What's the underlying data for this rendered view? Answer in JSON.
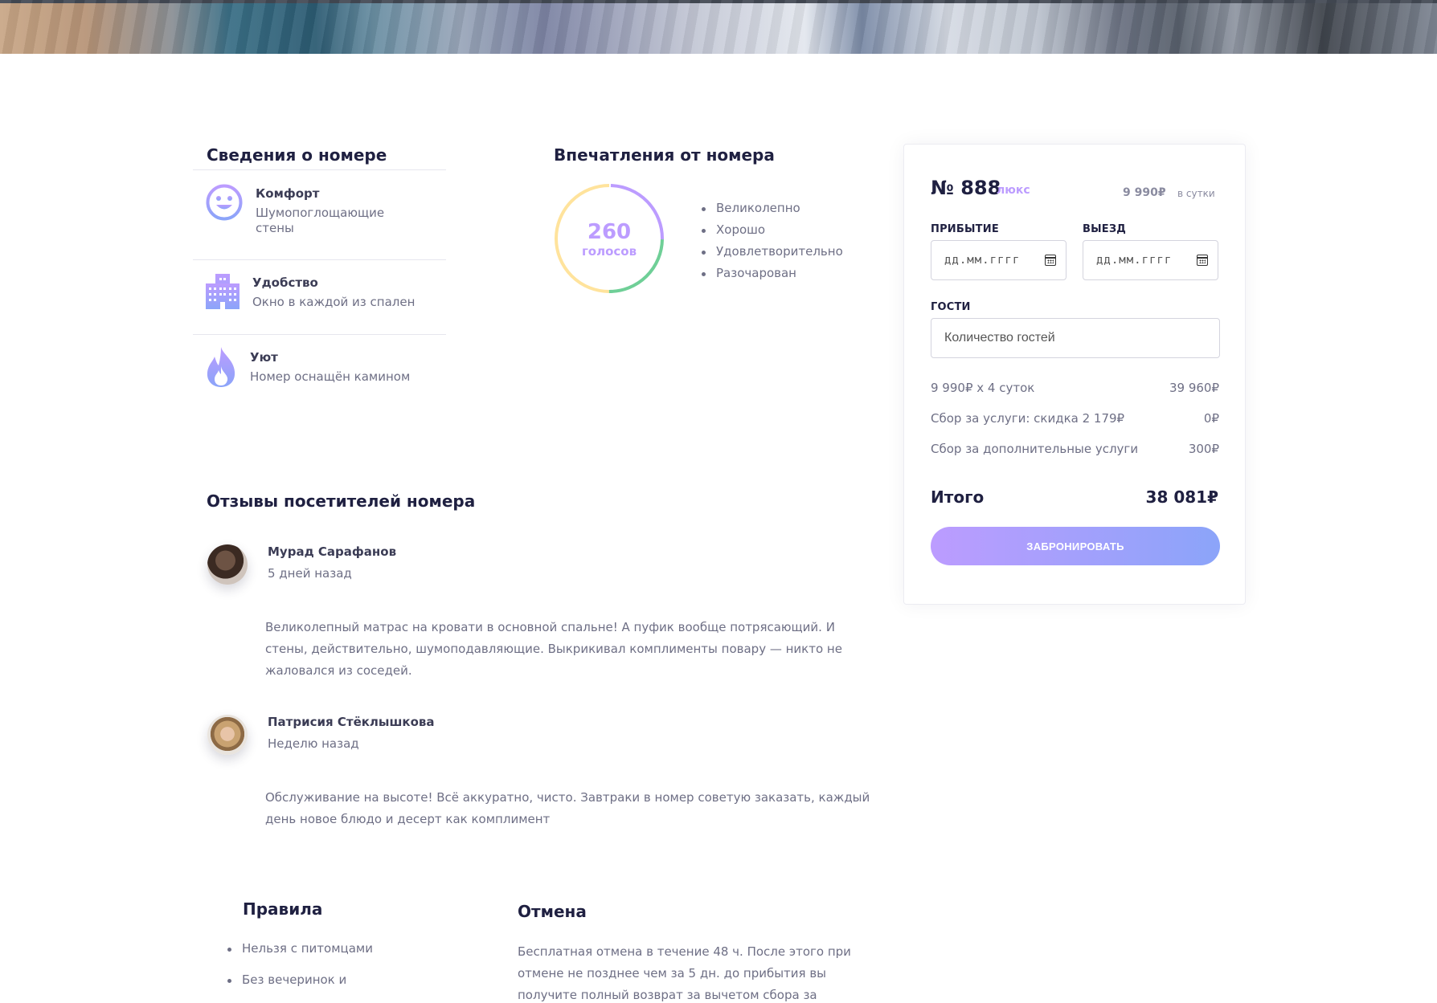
{
  "room_details": {
    "title": "Сведения о номере",
    "features": [
      {
        "icon": "smile-icon",
        "title": "Комфорт",
        "description": "Шумопоглощающие стены"
      },
      {
        "icon": "building-icon",
        "title": "Удобство",
        "description": "Окно в каждой из спален"
      },
      {
        "icon": "fire-icon",
        "title": "Уют",
        "description": "Номер оснащён камином"
      }
    ]
  },
  "impressions": {
    "title": "Впечатления от номера",
    "votes_count": "260",
    "votes_label": "голосов",
    "legend": [
      "Великолепно",
      "Хорошо",
      "Удовлетворительно",
      "Разочарован"
    ]
  },
  "booking": {
    "room_number": "№ 888",
    "room_type": "люкс",
    "price": "9 990₽",
    "price_unit": "в сутки",
    "arrival_label": "ПРИБЫТИЕ",
    "departure_label": "ВЫЕЗД",
    "date_placeholder": "дд.мм.гггг",
    "guests_label": "ГОСТИ",
    "guests_placeholder": "Количество гостей",
    "rows": [
      {
        "label": "9 990₽ х 4 суток",
        "value": "39 960₽"
      },
      {
        "label": "Сбор за услуги: скидка 2 179₽",
        "value": "0₽"
      },
      {
        "label": "Сбор за дополнительные услуги",
        "value": "300₽"
      }
    ],
    "total_label": "Итого",
    "total_value": "38 081₽",
    "button_label": "ЗАБРОНИРОВАТЬ"
  },
  "reviews": {
    "title": "Отзывы посетителей номера",
    "items": [
      {
        "name": "Мурад Сарафанов",
        "date": "5 дней назад",
        "text": "Великолепный матрас на кровати в основной спальне! А пуфик вообще потрясающий. И стены, действительно, шумоподавляющие. Выкрикивал комплименты повару — никто не жаловался из соседей."
      },
      {
        "name": "Патрисия Стёклышкова",
        "date": "Неделю назад",
        "text": "Обслуживание на высоте! Всё аккуратно, чисто. Завтраки в номер советую заказать, каждый день новое блюдо и десерт как комплимент"
      }
    ]
  },
  "rules": {
    "title": "Правила",
    "items": [
      "Нельзя с питомцами",
      "Без вечеринок и"
    ]
  },
  "cancellation": {
    "title": "Отмена",
    "text": "Бесплатная отмена в течение 48 ч. После этого при отмене не позднее чем за 5 дн. до прибытия вы получите полный возврат за вычетом сбора за"
  },
  "colors": {
    "primary_purple": "#bc9cff",
    "accent_blue": "#8ba4f9",
    "green": "#6fcf97",
    "yellow": "#ffe39c",
    "dark": "#1f2041"
  }
}
